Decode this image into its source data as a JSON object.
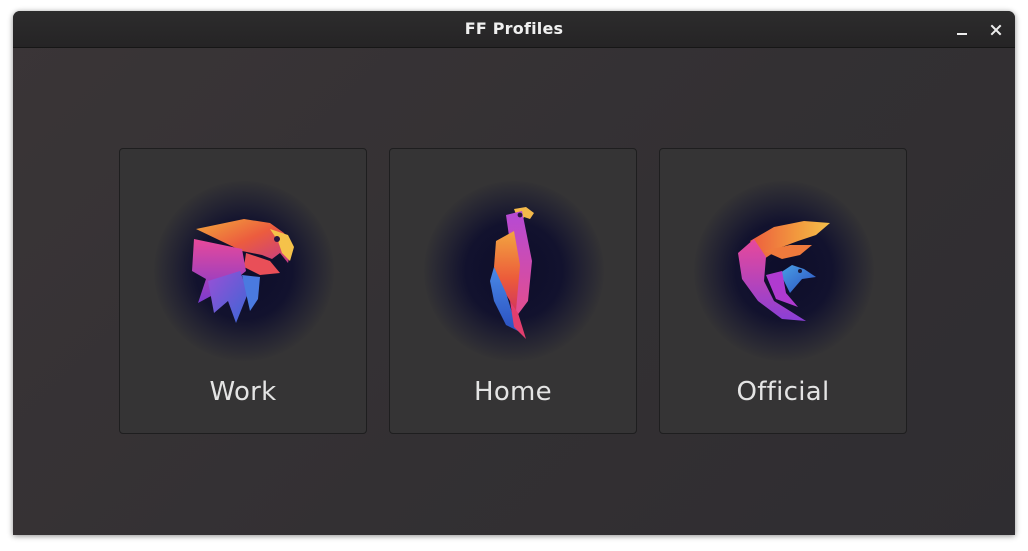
{
  "window": {
    "title": "FF Profiles"
  },
  "controls": {
    "minimize_icon": "minimize-icon",
    "close_icon": "close-icon"
  },
  "profiles": [
    {
      "label": "Work",
      "icon": "eagle-head-logo"
    },
    {
      "label": "Home",
      "icon": "parrot-logo"
    },
    {
      "label": "Official",
      "icon": "phoenix-wing-logo"
    }
  ],
  "colors": {
    "window_bg": "#353035",
    "card_bg": "#353435",
    "glow": "#0d0d2a",
    "text": "#e4e4e4"
  }
}
